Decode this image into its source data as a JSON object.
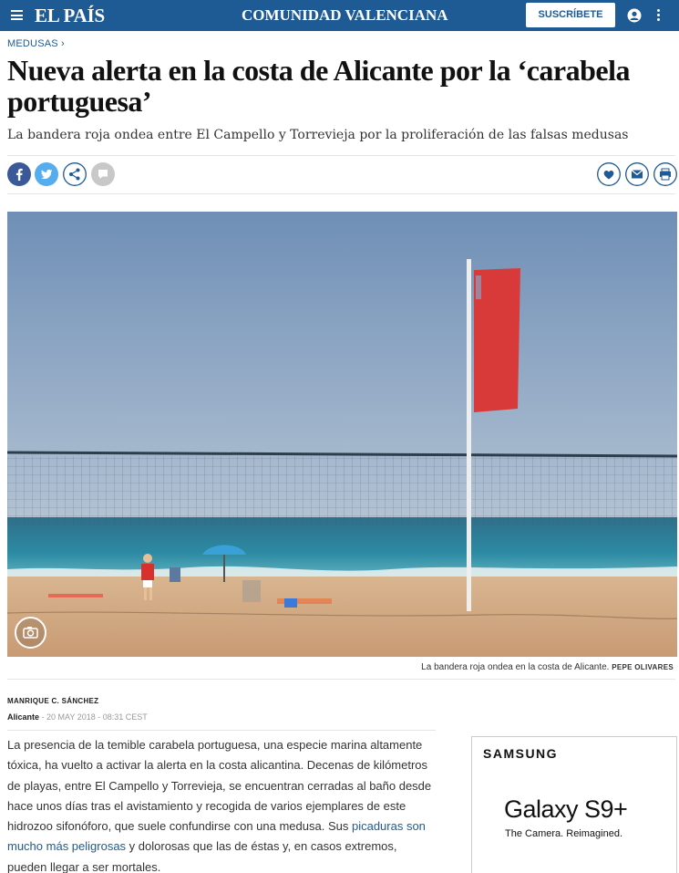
{
  "header": {
    "logo": "EL PAÍS",
    "section": "COMUNIDAD VALENCIANA",
    "subscribe_label": "SUSCRÍBETE",
    "icons": [
      "menu-icon",
      "user-icon",
      "more-vertical-icon"
    ]
  },
  "article": {
    "kicker": "MEDUSAS ›",
    "title": "Nueva alerta en la costa de Alicante por la ‘carabela portuguesa’",
    "subtitle": "La bandera roja ondea entre El Campello y Torrevieja por la proliferación de las falsas medusas",
    "share_icons": [
      "facebook-icon",
      "twitter-icon",
      "share-icon",
      "comment-icon"
    ],
    "action_icons": [
      "heart-icon",
      "mail-icon",
      "print-icon"
    ],
    "photo": {
      "caption": "La bandera roja ondea en la costa de Alicante.",
      "credit": "PEPE OLIVARES"
    },
    "author": "MANRIQUE C. SÁNCHEZ",
    "city": "Alicante",
    "date": "- 20 MAY 2018 - 08:31 CEST",
    "body": {
      "text_1": "La presencia de la temible carabela portuguesa, una especie marina altamente tóxica, ha vuelto a activar la alerta en la costa alicantina. Decenas de kilómetros de playas, entre El Campello y Torrevieja, se encuentran cerradas al baño desde hace unos días tras el avistamiento y recogida de varios ejemplares de este hidrozoo sifonóforo, que suele confundirse con una medusa. Sus ",
      "link": "picaduras son mucho más peligrosas",
      "text_2": " y dolorosas que las de éstas y, en casos extremos, pueden llegar a ser mortales."
    }
  },
  "ad": {
    "brand": "SAMSUNG",
    "model": "Galaxy S9+",
    "tagline": "The Camera. Reimagined."
  },
  "colors": {
    "brand_blue": "#1e5a93",
    "facebook": "#3b5998",
    "twitter": "#55acee"
  }
}
